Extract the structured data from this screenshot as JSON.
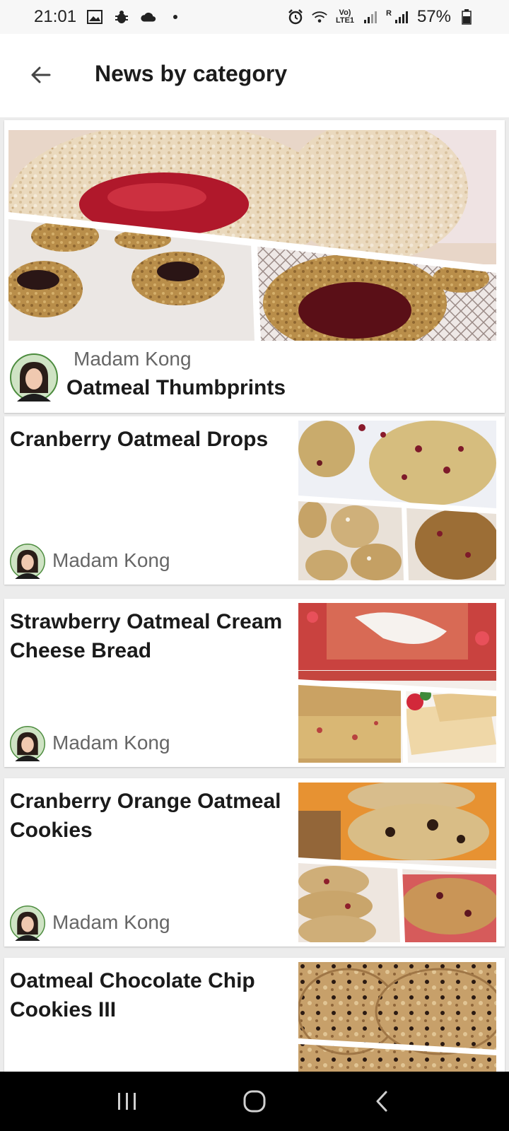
{
  "status_bar": {
    "time": "21:01",
    "network_top": "Vo)",
    "network_bottom": "LTE1",
    "sim_label": "R",
    "battery": "57%"
  },
  "app_bar": {
    "title": "News by category",
    "back_icon": "arrow-left-icon"
  },
  "featured": {
    "author": "Madam Kong",
    "title": "Oatmeal Thumbprints"
  },
  "articles": [
    {
      "title": "Cranberry Oatmeal Drops",
      "author": "Madam Kong"
    },
    {
      "title": "Strawberry Oatmeal Cream Cheese Bread",
      "author": "Madam Kong"
    },
    {
      "title": "Cranberry Orange Oatmeal Cookies",
      "author": "Madam Kong"
    },
    {
      "title": "Oatmeal Chocolate Chip Cookies III",
      "author": ""
    }
  ],
  "nav_bar": {
    "recents_icon": "recents-icon",
    "home_icon": "home-icon",
    "back_icon": "back-chevron-icon"
  },
  "colors": {
    "background": "#ececec",
    "card": "#ffffff",
    "nav_bar": "#000000",
    "author_text": "#666666"
  }
}
